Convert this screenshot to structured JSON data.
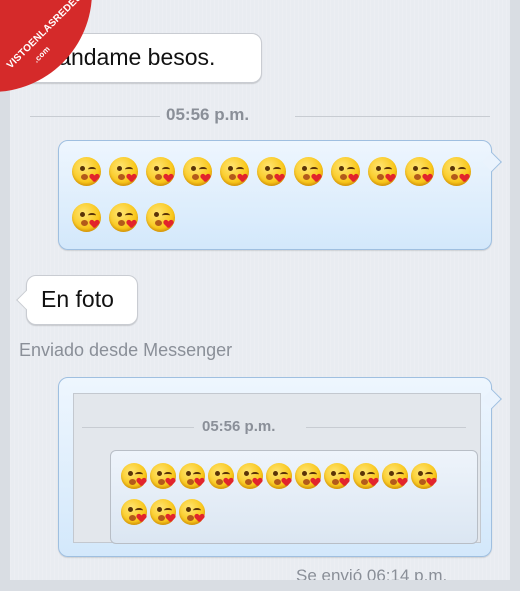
{
  "watermark": {
    "text": "VISTOENLASREDES",
    "domain": ".com"
  },
  "messages": {
    "incoming_1": "Mándame besos.",
    "timestamp_1": "05:56 p.m.",
    "outgoing_emoji": {
      "icon": "kissing-heart-face-icon",
      "row1_count": 11,
      "row2_count": 3
    },
    "incoming_2": "En foto",
    "sent_from": "Enviado desde Messenger",
    "photo": {
      "timestamp": "05:56 p.m.",
      "emoji": {
        "icon": "kissing-heart-face-icon",
        "row1_count": 11,
        "row2_count": 3
      }
    },
    "delivery_status": "Se envió 06:14 p.m."
  }
}
